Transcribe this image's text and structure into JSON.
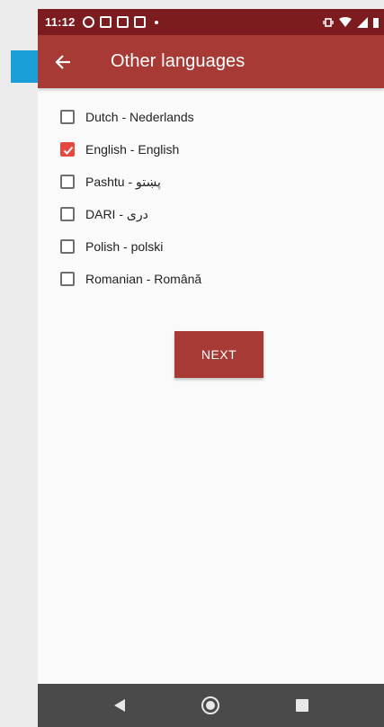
{
  "status_bar": {
    "time": "11:12",
    "left_icons": [
      "pinterest-icon",
      "notification-icon",
      "messenger-icon",
      "notification-icon"
    ],
    "right_icons": [
      "vibrate-icon",
      "wifi-icon",
      "signal-icon"
    ]
  },
  "app_bar": {
    "title": "Other languages",
    "back_icon": "arrow-back-icon"
  },
  "languages": [
    {
      "label": "Dutch - Nederlands",
      "checked": false
    },
    {
      "label": "English - English",
      "checked": true
    },
    {
      "label": "Pashtu - پښتو",
      "checked": false
    },
    {
      "label": "DARI - دری",
      "checked": false
    },
    {
      "label": "Polish - polski",
      "checked": false
    },
    {
      "label": "Romanian - Română",
      "checked": false
    }
  ],
  "next_button": {
    "label": "NEXT"
  },
  "nav_bar": {
    "icons": [
      "back-triangle-icon",
      "home-circle-icon",
      "recents-square-icon"
    ]
  },
  "colors": {
    "status_bar": "#7d1c1f",
    "app_bar": "#a83a36",
    "accent_checkbox": "#e5483e",
    "nav_bar": "#4a4a4a"
  }
}
